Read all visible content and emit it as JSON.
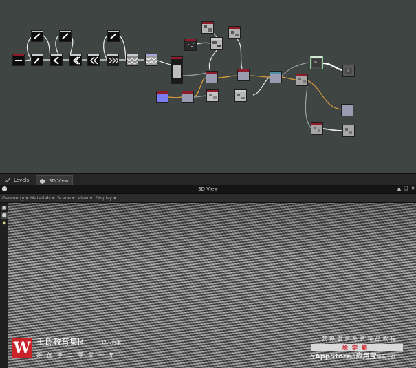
{
  "graph": {
    "nodes": [
      {
        "id": "n1",
        "kind": "black-bar"
      },
      {
        "id": "n2",
        "kind": "black-slash"
      },
      {
        "id": "n3",
        "kind": "black-chevron"
      },
      {
        "id": "n4",
        "kind": "black-chevron"
      },
      {
        "id": "n5",
        "kind": "black-chevron"
      },
      {
        "id": "n6",
        "kind": "black-chevron"
      },
      {
        "id": "n7",
        "kind": "gray-herringbone"
      },
      {
        "id": "n8",
        "kind": "gray-herringbone"
      },
      {
        "id": "n9",
        "kind": "gray-herringbone"
      },
      {
        "id": "n10",
        "kind": "black-slash"
      },
      {
        "id": "n11",
        "kind": "black-slash"
      },
      {
        "id": "n12",
        "kind": "black-slash"
      },
      {
        "id": "n13",
        "kind": "tall-gray"
      },
      {
        "id": "n14",
        "kind": "blue-solid"
      },
      {
        "id": "n15",
        "kind": "lavender"
      },
      {
        "id": "n16",
        "kind": "lavender"
      },
      {
        "id": "n17",
        "kind": "noise"
      },
      {
        "id": "n18",
        "kind": "noise"
      },
      {
        "id": "n19",
        "kind": "noise"
      },
      {
        "id": "n20",
        "kind": "noise"
      },
      {
        "id": "n21",
        "kind": "noise"
      },
      {
        "id": "n22",
        "kind": "lavender"
      },
      {
        "id": "n23",
        "kind": "lavender"
      },
      {
        "id": "n24",
        "kind": "noise"
      },
      {
        "id": "n25",
        "kind": "noise"
      },
      {
        "id": "n26",
        "kind": "output"
      },
      {
        "id": "n27",
        "kind": "output"
      },
      {
        "id": "n28",
        "kind": "lavender"
      },
      {
        "id": "n29",
        "kind": "noise"
      },
      {
        "id": "n30",
        "kind": "output"
      },
      {
        "id": "n31",
        "kind": "dark-noise"
      }
    ]
  },
  "tabs": [
    {
      "label": "Levels",
      "icon": "levels-icon"
    },
    {
      "label": "3D View",
      "icon": "cube-icon",
      "active": true
    }
  ],
  "panel": {
    "title": "3D View",
    "left_icon": "cube-icon",
    "right_icons": [
      "pin-icon",
      "restore-icon",
      "close-icon"
    ]
  },
  "menu": [
    "Geometry",
    "Materials",
    "Scene",
    "View",
    "Display"
  ],
  "tools": [
    "camera-icon",
    "select-icon",
    "light-icon"
  ],
  "watermark": {
    "logo_letter": "W",
    "name": "王氏教育集团",
    "slogan": "以人为本",
    "sub": "始创于二零零一年",
    "right_line1": "获得更多免费精品教程",
    "right_badge": "绘学霸",
    "right_line3_pre": "在",
    "right_line3_store": "AppStore",
    "right_line3_mid": "或",
    "right_line3_app": "应用宝",
    "right_line3_post": "搜索下载"
  },
  "colors": {
    "graph_bg": "#3e4543",
    "node_header_red": "#8e1b2b",
    "link_white": "#e8e8e8",
    "link_orange": "#d79b3a",
    "link_gray": "#9aa0a3"
  }
}
